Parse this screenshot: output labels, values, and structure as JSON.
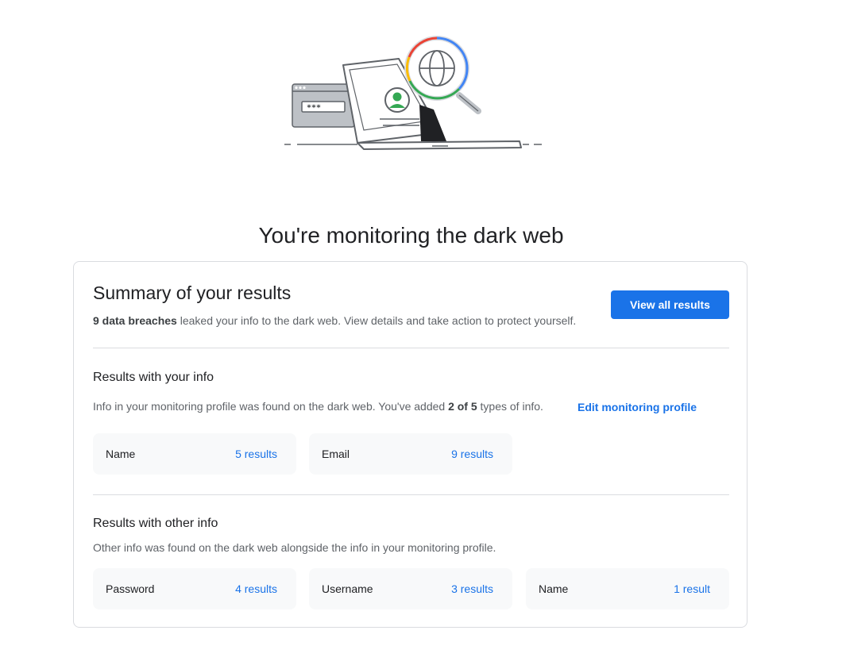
{
  "page": {
    "title": "You're monitoring the dark web"
  },
  "illustration": {
    "password_mask": "***"
  },
  "summary": {
    "title": "Summary of your results",
    "breach_count_text": "9 data breaches",
    "description_rest": " leaked your info to the dark web. View details and take action to protect yourself.",
    "view_all_label": "View all results",
    "accent_color": "#1a73e8"
  },
  "your_info": {
    "title": "Results with your info",
    "desc_prefix": "Info in your monitoring profile was found on the dark web. You've added ",
    "desc_bold": "2 of 5",
    "desc_suffix": " types of info.",
    "edit_link": "Edit monitoring profile",
    "items": [
      {
        "label": "Name",
        "count": "5 results"
      },
      {
        "label": "Email",
        "count": "9 results"
      }
    ]
  },
  "other_info": {
    "title": "Results with other info",
    "description": "Other info was found on the dark web alongside the info in your monitoring profile.",
    "items": [
      {
        "label": "Password",
        "count": "4 results"
      },
      {
        "label": "Username",
        "count": "3 results"
      },
      {
        "label": "Name",
        "count": "1 result"
      }
    ]
  }
}
